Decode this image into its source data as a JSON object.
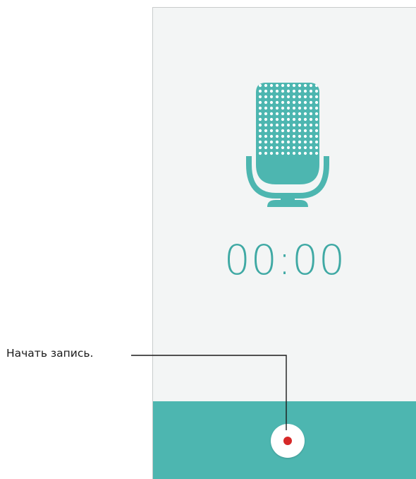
{
  "recorder": {
    "timer": "00:00",
    "accent_color": "#4db6b0",
    "record_dot_color": "#d62828",
    "icons": {
      "microphone": "microphone-icon",
      "record": "record-icon"
    }
  },
  "callouts": {
    "record_label": "Начать запись."
  }
}
